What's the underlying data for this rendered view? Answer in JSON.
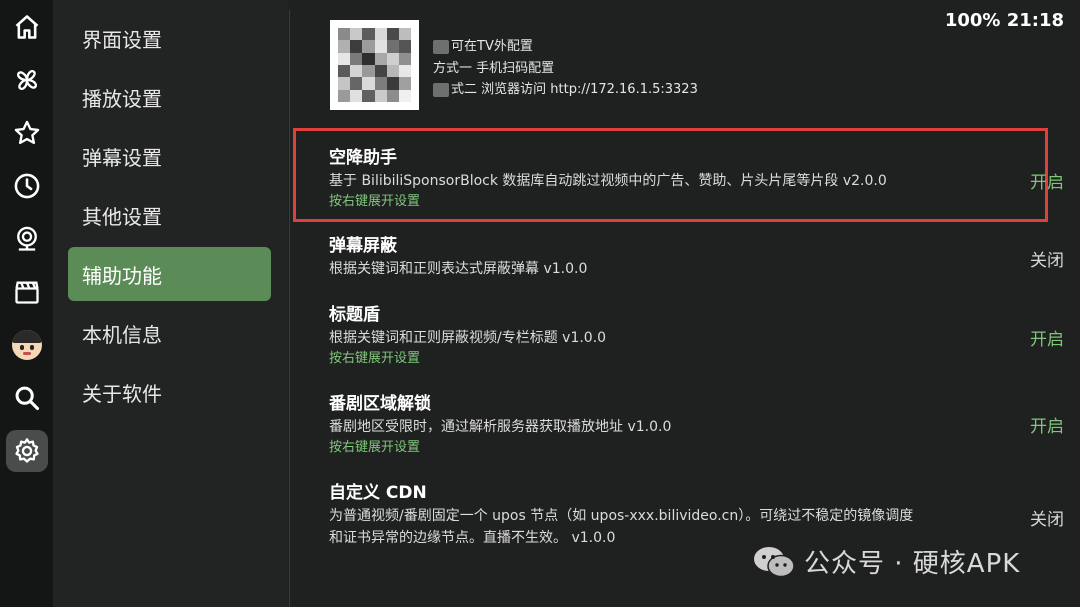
{
  "status": {
    "battery": "100%",
    "time": "21:18"
  },
  "rail": {
    "icons": [
      "home-icon",
      "pinwheel-icon",
      "star-icon",
      "clock-icon",
      "webcam-icon",
      "clapperboard-icon",
      "avatar",
      "search-icon",
      "gear-icon"
    ],
    "active": "gear-icon"
  },
  "menu": {
    "items": [
      {
        "label": "界面设置"
      },
      {
        "label": "播放设置"
      },
      {
        "label": "弹幕设置"
      },
      {
        "label": "其他设置"
      },
      {
        "label": "辅助功能"
      },
      {
        "label": "本机信息"
      },
      {
        "label": "关于软件"
      }
    ],
    "active_index": 4
  },
  "qr_config": {
    "line1": "可在TV外配置",
    "line2": "方式一 手机扫码配置",
    "line3": "式二 浏览器访问 http://172.16.1.5:3323"
  },
  "settings": [
    {
      "title": "空降助手",
      "desc": "基于 BilibiliSponsorBlock 数据库自动跳过视频中的广告、赞助、片头片尾等片段  v2.0.0",
      "hint": "按右键展开设置",
      "state": "开启"
    },
    {
      "title": "弹幕屏蔽",
      "desc": "根据关键词和正则表达式屏蔽弹幕  v1.0.0",
      "hint": "",
      "state": "关闭"
    },
    {
      "title": "标题盾",
      "desc": "根据关键词和正则屏蔽视频/专栏标题  v1.0.0",
      "hint": "按右键展开设置",
      "state": "开启"
    },
    {
      "title": "番剧区域解锁",
      "desc": "番剧地区受限时，通过解析服务器获取播放地址  v1.0.0",
      "hint": "按右键展开设置",
      "state": "开启"
    },
    {
      "title": "自定义 CDN",
      "desc": "为普通视频/番剧固定一个 upos 节点（如 upos-xxx.bilivideo.cn）。可绕过不稳定的镜像调度",
      "desc2": "和证书异常的边缘节点。直播不生效。  v1.0.0",
      "hint": "",
      "state": "关闭"
    }
  ],
  "watermark": {
    "text": "公众号 · 硬核APK"
  },
  "colors": {
    "accent_green": "#5b8c57",
    "on_text": "#7fc77a",
    "highlight_red": "#e0403d"
  }
}
